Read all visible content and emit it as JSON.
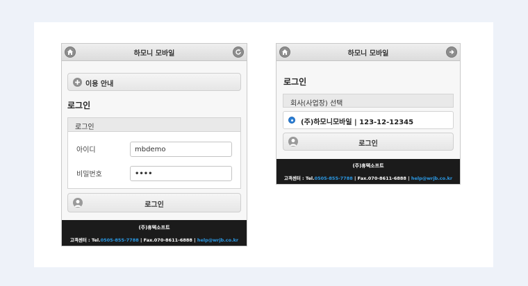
{
  "left": {
    "header_title": "하모니 모바일",
    "guide_button": "이용 안내",
    "login_heading": "로그인",
    "panel_title": "로그인",
    "id_label": "아이디",
    "id_value": "mbdemo",
    "pw_label": "비밀번호",
    "pw_value": "••••",
    "login_button": "로그인"
  },
  "right": {
    "header_title": "하모니 모바일",
    "login_heading": "로그인",
    "select_title": "회사(사업장) 선택",
    "company_option": "(주)하모니모바일 | 123-12-12345",
    "login_button": "로그인"
  },
  "footer": {
    "company": "(주)휴텍소프트",
    "cs_label": "고객센터 : Tel.",
    "tel": "0505-855-7788",
    "fax": " | Fax.070-8611-6888 | ",
    "email": "help@wrjb.co.kr"
  },
  "colors": {
    "accent": "#2b9ae6",
    "footer_bg": "#1b1b1b",
    "radio": "#2b7fd6"
  },
  "icons": {
    "home": "home-icon",
    "refresh": "refresh-icon",
    "plus": "plus-circle-icon",
    "user": "user-icon",
    "radio": "radio-selected-icon"
  }
}
